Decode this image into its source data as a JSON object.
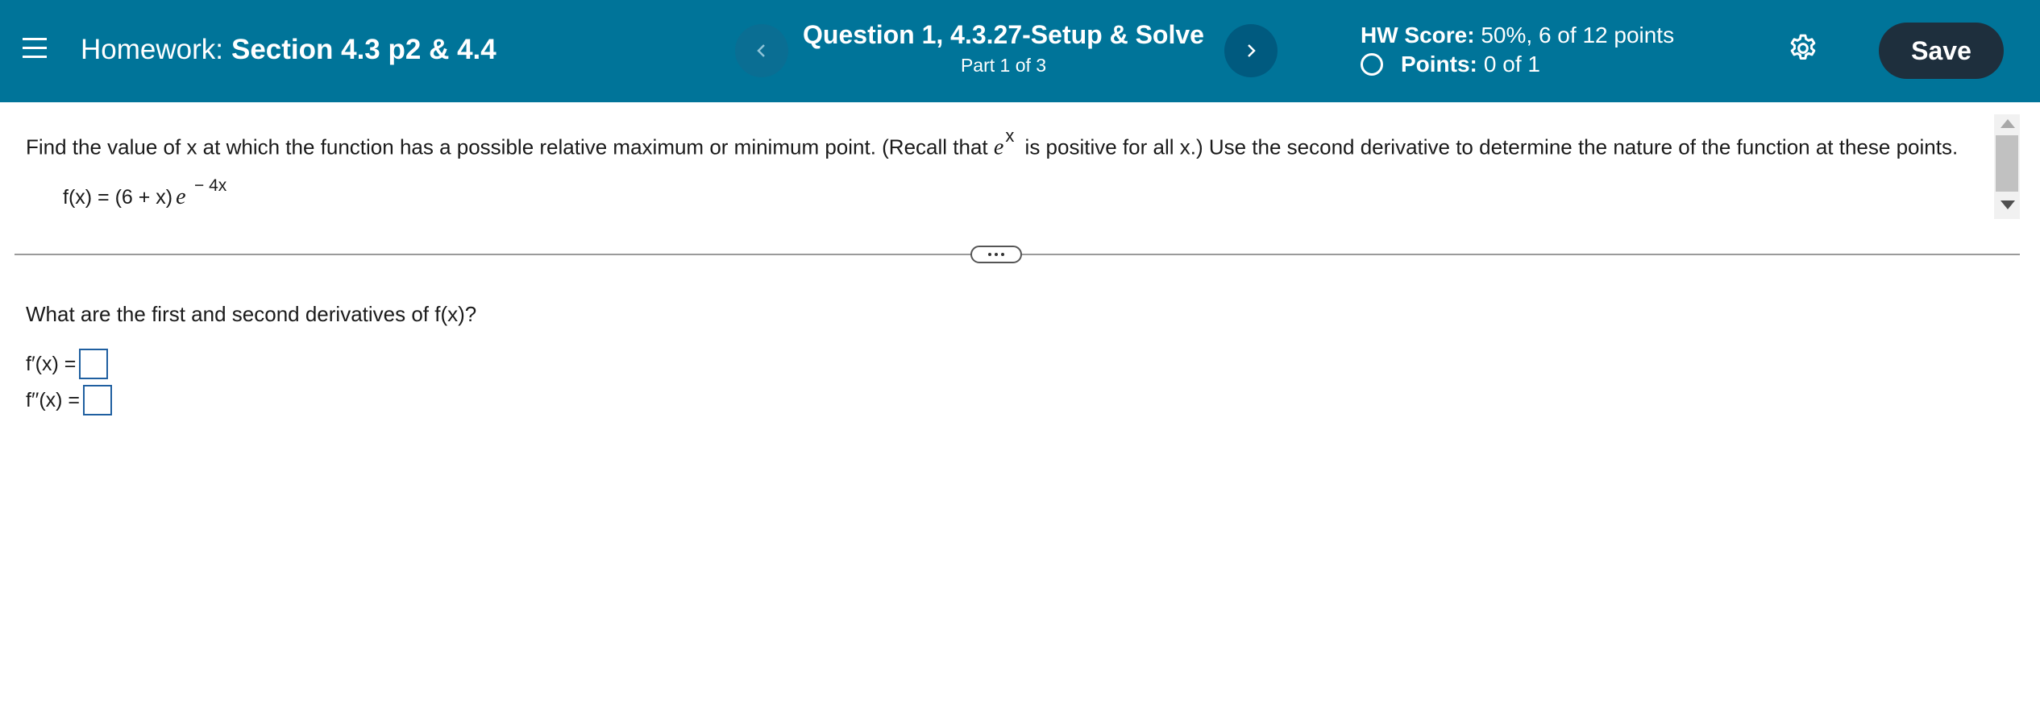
{
  "header": {
    "homework_prefix": "Homework:",
    "homework_name": "Section 4.3 p2 & 4.4",
    "question_title": "Question 1, 4.3.27-Setup & Solve",
    "question_part": "Part 1 of 3",
    "hw_score_label": "HW Score:",
    "hw_score_value": "50%, 6 of 12 points",
    "points_label": "Points:",
    "points_value": "0 of 1",
    "save_label": "Save",
    "prev_glyph": "‹",
    "next_glyph": "›",
    "icons": {
      "menu": "hamburger-menu-icon",
      "settings": "gear-icon",
      "points_status": "empty-circle-icon"
    },
    "colors": {
      "header_bg": "#007499",
      "save_bg": "#1e2f3d"
    }
  },
  "question": {
    "prompt_before": "Find the value of x at which the function has a possible relative maximum or minimum point. (Recall that ",
    "prompt_e": "e",
    "prompt_exp": "x",
    "prompt_after": " is positive for all x.) Use the second derivative to determine the nature of the function at these points.",
    "function_lhs": "f(x) = (6 + x)",
    "function_e": "e",
    "function_exp": "− 4x"
  },
  "part": {
    "prompt": "What are the first and second derivatives of f(x)?",
    "first_label": "f′(x) =",
    "second_label": "f′′(x) =",
    "first_value": "",
    "second_value": ""
  }
}
